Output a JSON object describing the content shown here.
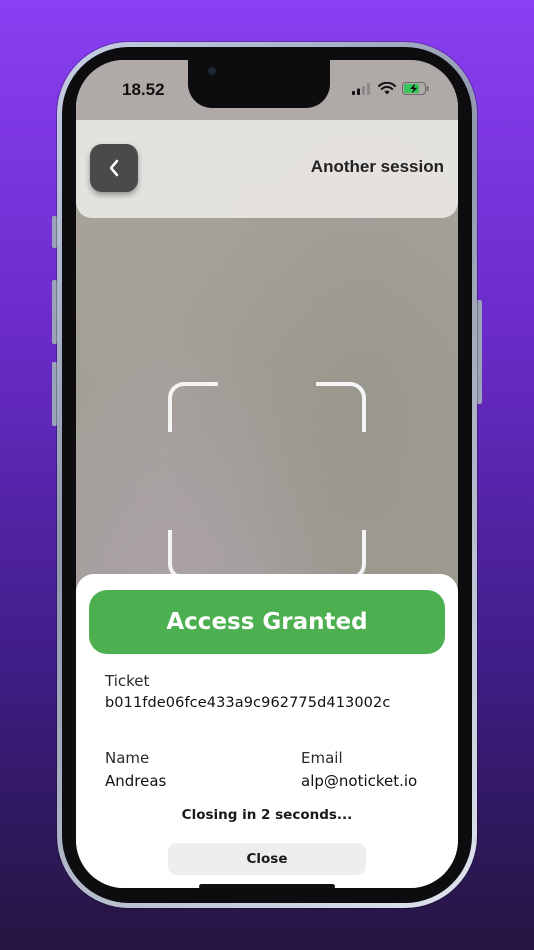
{
  "status_bar": {
    "time": "18.52",
    "icons": [
      "cellular-signal-icon",
      "wifi-icon",
      "battery-charging-icon"
    ]
  },
  "header": {
    "back_icon": "chevron-left-icon",
    "title": "Another session"
  },
  "scanner": {
    "frame_icon": "qr-scan-frame"
  },
  "result": {
    "status": "Access Granted",
    "status_color": "#4caf50",
    "ticket_label": "Ticket",
    "ticket_value": "b011fde06fce433a9c962775d413002c",
    "name_label": "Name",
    "name_value": "Andreas",
    "email_label": "Email",
    "email_value": "alp@noticket.io",
    "closing_text": "Closing in 2 seconds...",
    "close_label": "Close"
  },
  "colors": {
    "background_top": "#8a3ff2",
    "background_bottom": "#241540",
    "back_button": "#4a4a4a"
  }
}
